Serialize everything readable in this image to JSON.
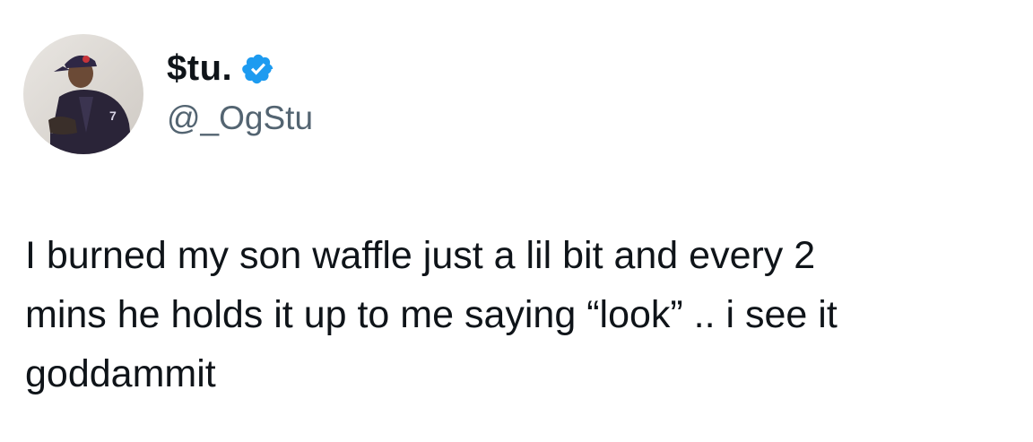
{
  "author": {
    "display_name": "$tu.",
    "handle": "@_OgStu",
    "verified": true,
    "avatar_icon": "profile-photo"
  },
  "tweet": {
    "text": "I burned my son waffle just a lil bit and every 2\nmins he holds it up to me saying “look” .. i see it\ngoddammit"
  },
  "colors": {
    "text": "#0f1419",
    "secondary": "#536471",
    "verified_badge": "#1d9bf0"
  }
}
